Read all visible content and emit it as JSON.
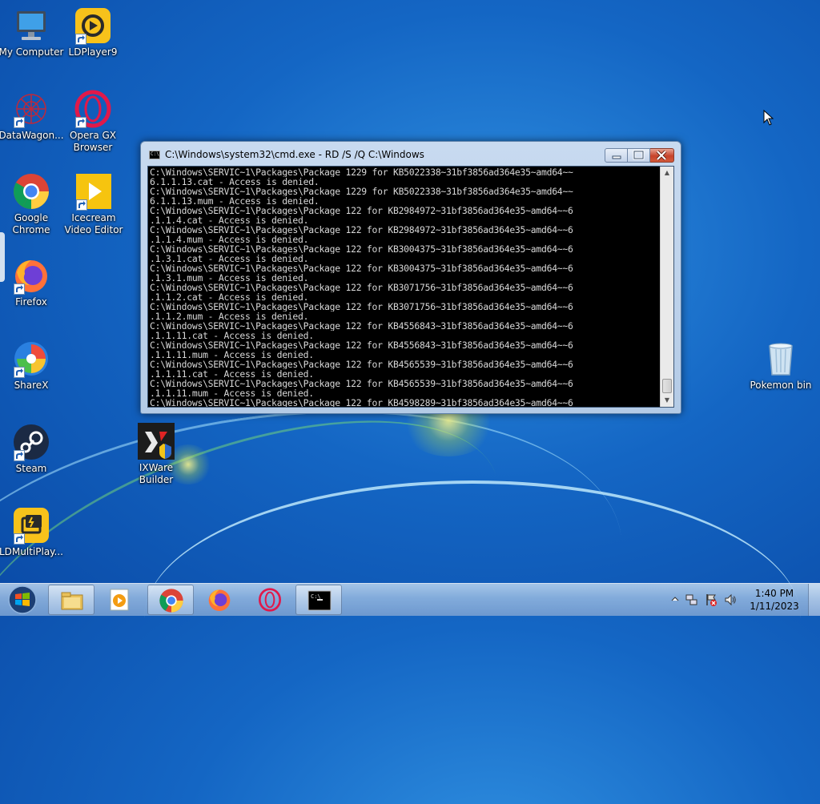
{
  "desktop": {
    "icons": [
      {
        "id": "my-computer",
        "label": "My Computer"
      },
      {
        "id": "ldplayer9",
        "label": "LDPlayer9"
      },
      {
        "id": "datawagon",
        "label": "DataWagon..."
      },
      {
        "id": "opera-gx",
        "label": "Opera GX Browser"
      },
      {
        "id": "google-chrome",
        "label": "Google Chrome"
      },
      {
        "id": "icecream-video-editor",
        "label": "Icecream Video Editor"
      },
      {
        "id": "firefox",
        "label": "Firefox"
      },
      {
        "id": "sharex",
        "label": "ShareX"
      },
      {
        "id": "steam",
        "label": "Steam"
      },
      {
        "id": "ixware-builder",
        "label": "IXWare Builder"
      },
      {
        "id": "ldmultiplayer",
        "label": "LDMultiPlay..."
      },
      {
        "id": "recycle-bin",
        "label": "Pokemon bin"
      }
    ]
  },
  "cmd_window": {
    "title": "C:\\Windows\\system32\\cmd.exe - RD  /S /Q C:\\Windows",
    "lines": [
      "C:\\Windows\\SERVIC~1\\Packages\\Package_1229_for_KB5022338~31bf3856ad364e35~amd64~~",
      "6.1.1.13.cat - Access is denied.",
      "C:\\Windows\\SERVIC~1\\Packages\\Package_1229_for_KB5022338~31bf3856ad364e35~amd64~~",
      "6.1.1.13.mum - Access is denied.",
      "C:\\Windows\\SERVIC~1\\Packages\\Package_122_for_KB2984972~31bf3856ad364e35~amd64~~6",
      ".1.1.4.cat - Access is denied.",
      "C:\\Windows\\SERVIC~1\\Packages\\Package_122_for_KB2984972~31bf3856ad364e35~amd64~~6",
      ".1.1.4.mum - Access is denied.",
      "C:\\Windows\\SERVIC~1\\Packages\\Package_122_for_KB3004375~31bf3856ad364e35~amd64~~6",
      ".1.3.1.cat - Access is denied.",
      "C:\\Windows\\SERVIC~1\\Packages\\Package_122_for_KB3004375~31bf3856ad364e35~amd64~~6",
      ".1.3.1.mum - Access is denied.",
      "C:\\Windows\\SERVIC~1\\Packages\\Package_122_for_KB3071756~31bf3856ad364e35~amd64~~6",
      ".1.1.2.cat - Access is denied.",
      "C:\\Windows\\SERVIC~1\\Packages\\Package_122_for_KB3071756~31bf3856ad364e35~amd64~~6",
      ".1.1.2.mum - Access is denied.",
      "C:\\Windows\\SERVIC~1\\Packages\\Package_122_for_KB4556843~31bf3856ad364e35~amd64~~6",
      ".1.1.11.cat - Access is denied.",
      "C:\\Windows\\SERVIC~1\\Packages\\Package_122_for_KB4556843~31bf3856ad364e35~amd64~~6",
      ".1.1.11.mum - Access is denied.",
      "C:\\Windows\\SERVIC~1\\Packages\\Package_122_for_KB4565539~31bf3856ad364e35~amd64~~6",
      ".1.1.11.cat - Access is denied.",
      "C:\\Windows\\SERVIC~1\\Packages\\Package_122_for_KB4565539~31bf3856ad364e35~amd64~~6",
      ".1.1.11.mum - Access is denied.",
      "C:\\Windows\\SERVIC~1\\Packages\\Package_122_for_KB4598289~31bf3856ad364e35~amd64~~6"
    ]
  },
  "taskbar": {
    "items": [
      "start-orb",
      "windows-explorer",
      "icecream-video-editor",
      "google-chrome",
      "firefox",
      "opera-gx",
      "cmd"
    ],
    "active": "cmd",
    "clock": {
      "time": "1:40 PM",
      "date": "1/11/2023"
    }
  },
  "colors": {
    "console_bg": "#000000",
    "console_text": "#d8d8d8",
    "close_button": "#c7432b"
  }
}
